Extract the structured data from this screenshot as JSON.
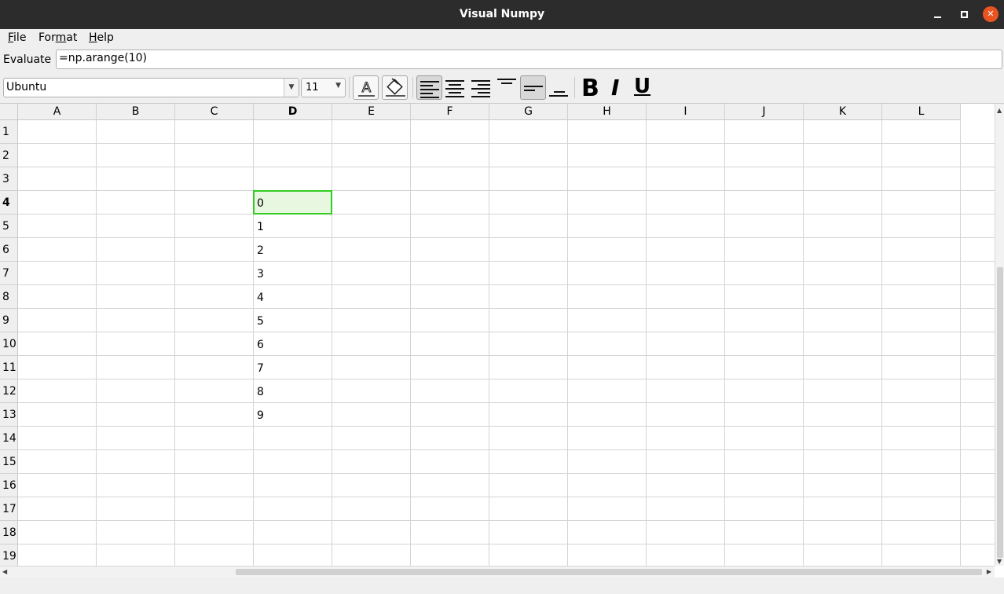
{
  "window": {
    "title": "Visual Numpy"
  },
  "menu": [
    {
      "first": "F",
      "rest": "ile"
    },
    {
      "pre": "For",
      "ul": "m",
      "post": "at"
    },
    {
      "first": "H",
      "rest": "elp"
    }
  ],
  "evaluate": {
    "label": "Evaluate :",
    "value": "=np.arange(10)"
  },
  "toolbar": {
    "font": "Ubuntu",
    "size": "11",
    "bold": "B",
    "italic": "I",
    "underline": "U"
  },
  "grid": {
    "columns": [
      "A",
      "B",
      "C",
      "D",
      "E",
      "F",
      "G",
      "H",
      "I",
      "J",
      "K",
      "L"
    ],
    "rows": [
      "1",
      "2",
      "3",
      "4",
      "5",
      "6",
      "7",
      "8",
      "9",
      "10",
      "11",
      "12",
      "13",
      "14",
      "15",
      "16",
      "17",
      "18",
      "19"
    ],
    "active_column": "D",
    "active_row": "4",
    "selected_cell": "D4",
    "cells": [
      {
        "ref": "D4",
        "value": "0"
      },
      {
        "ref": "D5",
        "value": "1"
      },
      {
        "ref": "D6",
        "value": "2"
      },
      {
        "ref": "D7",
        "value": "3"
      },
      {
        "ref": "D8",
        "value": "4"
      },
      {
        "ref": "D9",
        "value": "5"
      },
      {
        "ref": "D10",
        "value": "6"
      },
      {
        "ref": "D11",
        "value": "7"
      },
      {
        "ref": "D12",
        "value": "8"
      },
      {
        "ref": "D13",
        "value": "9"
      }
    ]
  },
  "colors": {
    "titlebar": "#2c2c2c",
    "close": "#e95420",
    "selection_border": "#33cc22",
    "selection_fill": "#e8f8e0"
  }
}
